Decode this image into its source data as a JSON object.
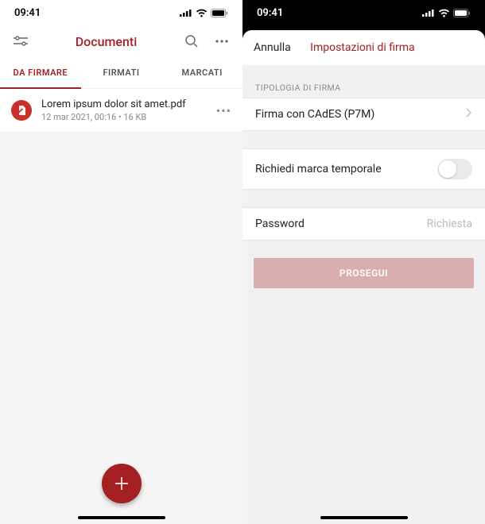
{
  "colors": {
    "accent": "#a41f22",
    "fab": "#a41f22"
  },
  "status": {
    "time": "09:41"
  },
  "left": {
    "title": "Documenti",
    "tabs": [
      {
        "label": "DA FIRMARE",
        "active": true
      },
      {
        "label": "FIRMATI",
        "active": false
      },
      {
        "label": "MARCATI",
        "active": false
      }
    ],
    "documents": [
      {
        "name": "Lorem ipsum dolor sit amet.pdf",
        "meta": "12 mar 2021, 00:16 • 16 KB"
      }
    ]
  },
  "right": {
    "cancel": "Annulla",
    "title": "Impostazioni di firma",
    "section_header": "TIPOLOGIA DI FIRMA",
    "signature_type": "Firma con CAdES (P7M)",
    "timestamp_label": "Richiedi marca temporale",
    "timestamp_on": false,
    "password_label": "Password",
    "password_placeholder": "Richiesta",
    "proceed": "PROSEGUI"
  }
}
